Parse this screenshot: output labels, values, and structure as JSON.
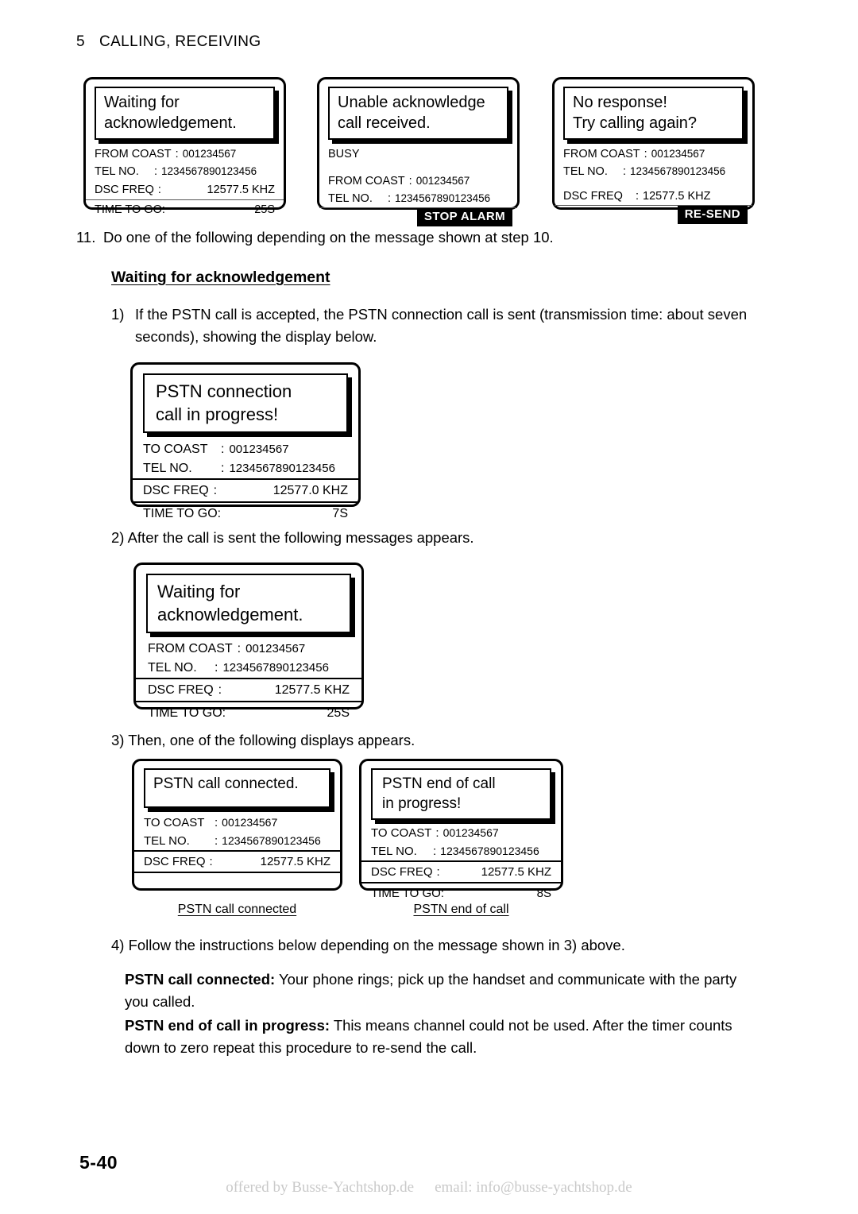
{
  "page": {
    "chapter_number": "5",
    "chapter_title": "CALLING, RECEIVING",
    "page_number": "5-40",
    "watermark_left": "offered by Busse-Yachtshop.de",
    "watermark_right": "email: info@busse-yachtshop.de"
  },
  "step11": {
    "number": "11.",
    "text": "Do one of the following depending on the message shown at step 10."
  },
  "section_heading": "Waiting for acknowledgement",
  "steps": {
    "one": {
      "number": "1)",
      "text": "If the PSTN call is accepted, the PSTN connection call is sent (transmission time: about seven seconds), showing the display below."
    },
    "two": "2) After the call is sent the following messages appears.",
    "three": "3) Then, one of the following displays appears.",
    "four": "4) Follow the instructions below depending on the message shown in 3) above."
  },
  "paragraphs": {
    "connected_label": "PSTN call connected:",
    "connected_text": " Your phone rings; pick up the handset and communicate with the party you called.",
    "endcall_label": "PSTN end of call in progress:",
    "endcall_text": " This means channel could not be used. After the timer counts down to zero repeat this procedure to re-send the call."
  },
  "panels": {
    "waiting_top": {
      "banner_line1": "Waiting for",
      "banner_line2": "acknowledgement.",
      "from_coast_label": "FROM COAST",
      "from_coast_colon": ":",
      "from_coast_value": "001234567",
      "tel_label": "TEL NO.",
      "tel_colon": ":",
      "tel_value": "1234567890123456",
      "dsc_label": "DSC FREQ",
      "dsc_colon": ":",
      "dsc_value": "12577.5 KHZ",
      "time_label": "TIME TO GO:",
      "time_value": "25S"
    },
    "unable": {
      "banner_line1": "Unable acknowledge",
      "banner_line2": "call received.",
      "status": "BUSY",
      "from_coast_label": "FROM COAST",
      "from_coast_colon": ":",
      "from_coast_value": "001234567",
      "tel_label": "TEL NO.",
      "tel_colon": ":",
      "tel_value": "1234567890123456",
      "softkey": "STOP ALARM"
    },
    "no_response": {
      "banner_line1": "No response!",
      "banner_line2": "Try calling again?",
      "from_coast_label": "FROM COAST",
      "from_coast_colon": ":",
      "from_coast_value": "001234567",
      "tel_label": "TEL NO.",
      "tel_colon": ":",
      "tel_value": "1234567890123456",
      "dsc_label": "DSC FREQ",
      "dsc_colon": ":",
      "dsc_value": "12577.5 KHZ",
      "softkey": "RE-SEND"
    },
    "pstn_connection": {
      "banner_line1": "PSTN connection",
      "banner_line2": "call in progress!",
      "to_coast_label": "TO COAST",
      "to_coast_colon": ":",
      "to_coast_value": "001234567",
      "tel_label": "TEL NO.",
      "tel_colon": ":",
      "tel_value": "1234567890123456",
      "dsc_label": "DSC FREQ",
      "dsc_colon": ":",
      "dsc_value": "12577.0 KHZ",
      "time_label": "TIME TO GO:",
      "time_value": "7S"
    },
    "waiting_mid": {
      "banner_line1": "Waiting for",
      "banner_line2": "acknowledgement.",
      "from_coast_label": "FROM COAST",
      "from_coast_colon": ":",
      "from_coast_value": "001234567",
      "tel_label": "TEL NO.",
      "tel_colon": ":",
      "tel_value": "1234567890123456",
      "dsc_label": "DSC FREQ",
      "dsc_colon": ":",
      "dsc_value": "12577.5 KHZ",
      "time_label": "TIME TO GO:",
      "time_value": "25S"
    },
    "call_connected": {
      "banner_line1": "PSTN call connected.",
      "banner_line2": "",
      "to_coast_label": "TO COAST",
      "to_coast_colon": ":",
      "to_coast_value": "001234567",
      "tel_label": "TEL NO.",
      "tel_colon": ":",
      "tel_value": "1234567890123456",
      "dsc_label": "DSC FREQ",
      "dsc_colon": ":",
      "dsc_value": "12577.5 KHZ",
      "caption": "PSTN call connected"
    },
    "end_of_call": {
      "banner_line1": "PSTN end of call",
      "banner_line2": "in progress!",
      "to_coast_label": "TO COAST",
      "to_coast_colon": ":",
      "to_coast_value": "001234567",
      "tel_label": "TEL NO.",
      "tel_colon": ":",
      "tel_value": "1234567890123456",
      "dsc_label": "DSC FREQ",
      "dsc_colon": ":",
      "dsc_value": "12577.5 KHZ",
      "time_label": "TIME TO GO:",
      "time_value": "8S",
      "caption": "PSTN end of call"
    }
  }
}
